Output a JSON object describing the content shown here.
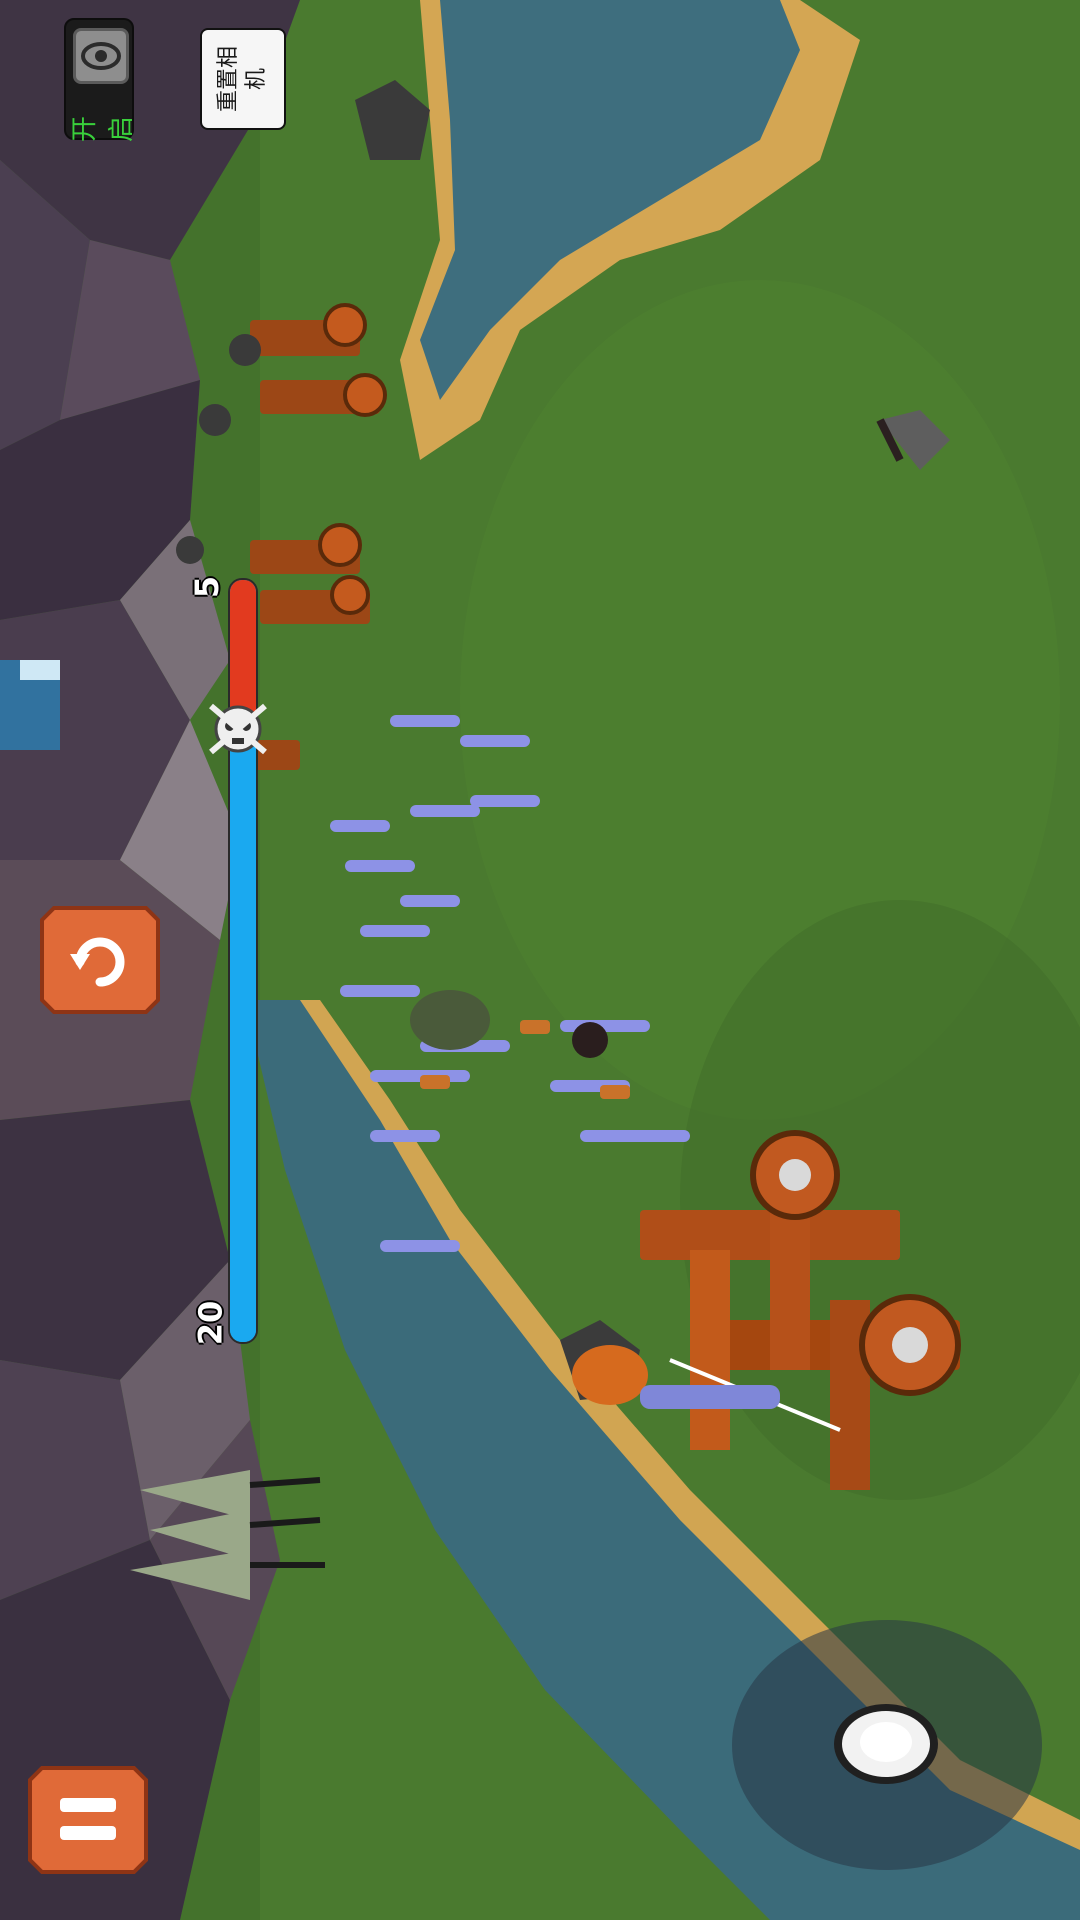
{
  "hud": {
    "camera_toggle_label": "开启",
    "reset_camera_label": "重置相机",
    "enemy_count": "5",
    "ally_count": "20",
    "health_ratio": {
      "enemy": 5,
      "ally": 20
    }
  },
  "icons": {
    "camera_toggle": "eye-icon",
    "restart": "restart-icon",
    "pause": "pause-icon",
    "skull": "skull-icon",
    "joystick": "joystick-icon"
  },
  "colors": {
    "enemy_team": "#e23a1f",
    "ally_team": "#1aa9f0",
    "button_orange": "#e06a38",
    "toggle_text": "#39d03b"
  }
}
